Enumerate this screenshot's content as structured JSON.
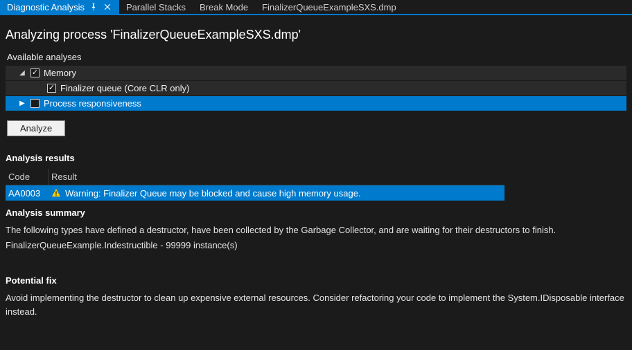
{
  "tabs": {
    "active": "Diagnostic Analysis",
    "items": [
      "Parallel Stacks",
      "Break Mode",
      "FinalizerQueueExampleSXS.dmp"
    ]
  },
  "page_title": "Analyzing process 'FinalizerQueueExampleSXS.dmp'",
  "analyses": {
    "label": "Available analyses",
    "tree": {
      "root": {
        "label": "Memory",
        "checked": true,
        "expanded": true
      },
      "child1": {
        "label": "Finalizer queue (Core CLR only)",
        "checked": true
      },
      "child2": {
        "label": "Process responsiveness",
        "checked": false,
        "expanded": false,
        "selected": true
      }
    },
    "analyze_button": "Analyze"
  },
  "results": {
    "heading": "Analysis results",
    "columns": {
      "code": "Code",
      "result": "Result"
    },
    "row": {
      "code": "AA0003",
      "message": "Warning: Finalizer Queue may be blocked and cause high memory usage.",
      "selected": true
    }
  },
  "summary": {
    "heading": "Analysis summary",
    "line1": "The following types have defined a destructor, have been collected by the Garbage Collector, and are waiting for their destructors to finish.",
    "line2": "FinalizerQueueExample.Indestructible - 99999 instance(s)"
  },
  "fix": {
    "heading": "Potential fix",
    "text": "Avoid implementing the destructor to clean up expensive external resources. Consider refactoring your code to implement the System.IDisposable interface instead."
  }
}
